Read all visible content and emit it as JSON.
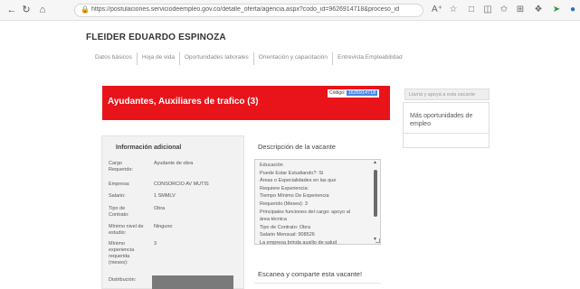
{
  "browser": {
    "url": "https://postulaciones.serviciodeempleo.gov.co/detalle_oferta/agencia.aspx?codo_id=9626914718&proceso_ide=484&op_ide=1"
  },
  "header": {
    "user_name": "FLEIDER EDUARDO ESPINOZA",
    "tabs": [
      "Datos básicos",
      "Hoja de vida",
      "Oportunidades laborales",
      "Orientación y capacitación",
      "Entrevista Empleabilidad"
    ]
  },
  "vacancy": {
    "title": "Ayudantes, Auxiliares de trafico (3)",
    "code_label": "Código:",
    "code_value": "1626914718"
  },
  "sidebar": {
    "help_heading": "Llamá y apoyá a esta vacante",
    "more_link": "Más oportunidades de empleo"
  },
  "info": {
    "title": "Información adicional",
    "rows": [
      {
        "label": "Cargo Requerido:",
        "value": "Ayudante de obra"
      },
      {
        "label": "Empresa:",
        "value": "CONSORCIO AV MUTIS"
      },
      {
        "label": "Salario:",
        "value": "1 SMMLV"
      },
      {
        "label": "Tipo de Contrato:",
        "value": "Obra"
      },
      {
        "label": "Mínimo nivel de estudio:",
        "value": "Ninguno"
      },
      {
        "label": "Mínimo experiencia requerida (meses):",
        "value": "3"
      },
      {
        "label": "Distribución:",
        "value": ""
      }
    ]
  },
  "description": {
    "title": "Descripción de la vacante",
    "lines": [
      "Educación",
      "Puede Estar Estudiando?: Si",
      "Áreas o Especialidades en las que",
      "Requiere Experiencia:",
      "Tiempo Mínimo De Experiencia",
      "Requerido (Meses): 3",
      "Principales funciones del cargo: apoyo al",
      "área técnica",
      "Tipo de Contrato: Obra",
      "Salario Mensual: 908526",
      "La empresa brinda auxilio de salud"
    ]
  },
  "share": {
    "title": "Escanea y comparte esta vacante!"
  }
}
